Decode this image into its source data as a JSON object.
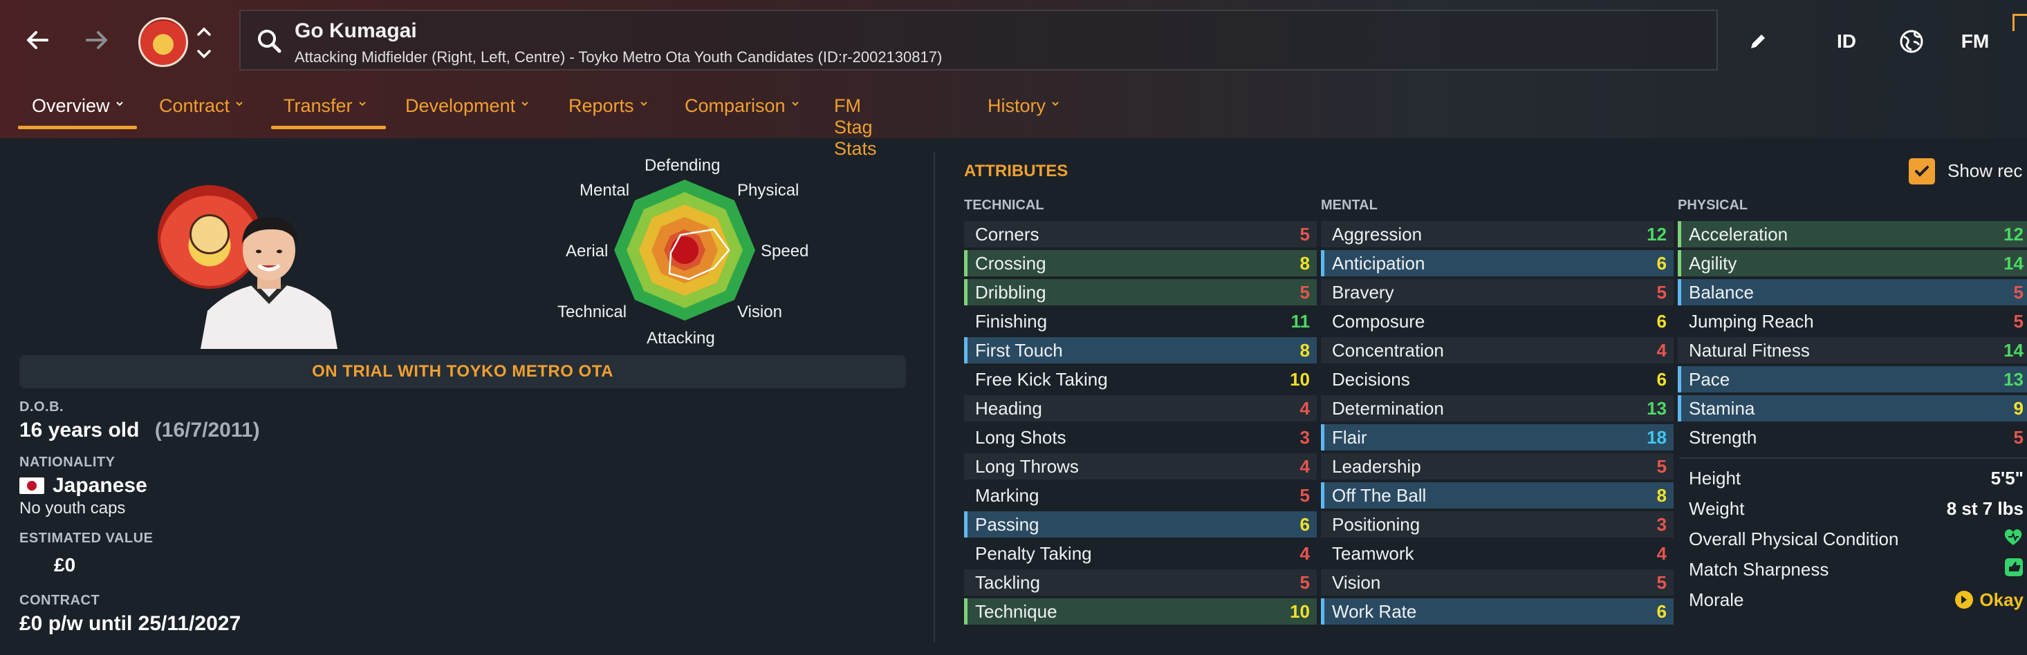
{
  "header": {
    "player_name": "Go Kumagai",
    "player_subtitle": "Attacking Midfielder (Right, Left, Centre) - Toyko Metro Ota Youth Candidates (ID:r-2002130817)",
    "id_button": "ID",
    "fm_button": "FM",
    "icons": {
      "back": "back-arrow-icon",
      "forward": "forward-arrow-icon",
      "search": "search-icon",
      "edit": "pencil-icon",
      "world": "globe-icon"
    }
  },
  "tabs": [
    {
      "label": "Overview",
      "active": true,
      "has_menu": true
    },
    {
      "label": "Contract",
      "active": false,
      "has_menu": true
    },
    {
      "label": "Transfer",
      "active": false,
      "has_menu": true
    },
    {
      "label": "Development",
      "active": false,
      "has_menu": true
    },
    {
      "label": "Reports",
      "active": false,
      "has_menu": true
    },
    {
      "label": "Comparison",
      "active": false,
      "has_menu": true
    },
    {
      "label": "FM Stag Stats",
      "active": false,
      "has_menu": false
    },
    {
      "label": "History",
      "active": false,
      "has_menu": true
    }
  ],
  "polar": {
    "labels": {
      "top": "Defending",
      "top_left": "Mental",
      "top_right": "Physical",
      "left": "Aerial",
      "right": "Speed",
      "bottom_left": "Technical",
      "bottom_right": "Vision",
      "bottom": "Attacking"
    }
  },
  "status_banner": "ON TRIAL WITH TOYKO METRO OTA",
  "info": {
    "dob_label": "D.O.B.",
    "age": "16 years old",
    "dob": "(16/7/2011)",
    "nationality_label": "NATIONALITY",
    "nationality": "Japanese",
    "caps": "No youth caps",
    "value_label": "ESTIMATED VALUE",
    "value": "£0",
    "contract_label": "CONTRACT",
    "contract": "£0 p/w until 25/11/2027"
  },
  "attributes": {
    "title": "ATTRIBUTES",
    "show_rec_label": "Show rec",
    "show_rec_checked": true,
    "technical_label": "TECHNICAL",
    "mental_label": "MENTAL",
    "physical_label": "PHYSICAL",
    "technical": [
      {
        "name": "Corners",
        "value": "5"
      },
      {
        "name": "Crossing",
        "value": "8"
      },
      {
        "name": "Dribbling",
        "value": "5"
      },
      {
        "name": "Finishing",
        "value": "11"
      },
      {
        "name": "First Touch",
        "value": "8"
      },
      {
        "name": "Free Kick Taking",
        "value": "10"
      },
      {
        "name": "Heading",
        "value": "4"
      },
      {
        "name": "Long Shots",
        "value": "3"
      },
      {
        "name": "Long Throws",
        "value": "4"
      },
      {
        "name": "Marking",
        "value": "5"
      },
      {
        "name": "Passing",
        "value": "6"
      },
      {
        "name": "Penalty Taking",
        "value": "4"
      },
      {
        "name": "Tackling",
        "value": "5"
      },
      {
        "name": "Technique",
        "value": "10"
      }
    ],
    "mental": [
      {
        "name": "Aggression",
        "value": "12"
      },
      {
        "name": "Anticipation",
        "value": "6"
      },
      {
        "name": "Bravery",
        "value": "5"
      },
      {
        "name": "Composure",
        "value": "6"
      },
      {
        "name": "Concentration",
        "value": "4"
      },
      {
        "name": "Decisions",
        "value": "6"
      },
      {
        "name": "Determination",
        "value": "13"
      },
      {
        "name": "Flair",
        "value": "18"
      },
      {
        "name": "Leadership",
        "value": "5"
      },
      {
        "name": "Off The Ball",
        "value": "8"
      },
      {
        "name": "Positioning",
        "value": "3"
      },
      {
        "name": "Teamwork",
        "value": "4"
      },
      {
        "name": "Vision",
        "value": "5"
      },
      {
        "name": "Work Rate",
        "value": "6"
      }
    ],
    "physical": [
      {
        "name": "Acceleration",
        "value": "12"
      },
      {
        "name": "Agility",
        "value": "14"
      },
      {
        "name": "Balance",
        "value": "5"
      },
      {
        "name": "Jumping Reach",
        "value": "5"
      },
      {
        "name": "Natural Fitness",
        "value": "14"
      },
      {
        "name": "Pace",
        "value": "13"
      },
      {
        "name": "Stamina",
        "value": "9"
      },
      {
        "name": "Strength",
        "value": "5"
      }
    ]
  },
  "physical_info": {
    "height_label": "Height",
    "height": "5'5\"",
    "weight_label": "Weight",
    "weight": "8 st 7 lbs",
    "condition_label": "Overall Physical Condition",
    "sharpness_label": "Match Sharpness",
    "morale_label": "Morale",
    "morale": "Okay"
  }
}
